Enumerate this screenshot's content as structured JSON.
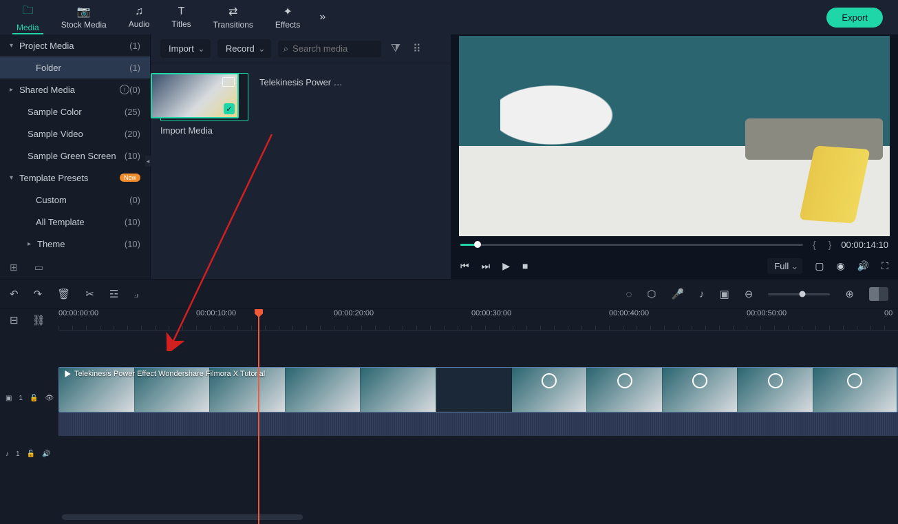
{
  "tabs": {
    "media": "Media",
    "stock": "Stock Media",
    "audio": "Audio",
    "titles": "Titles",
    "transitions": "Transitions",
    "effects": "Effects"
  },
  "export_label": "Export",
  "sidebar": {
    "project_media": {
      "label": "Project Media",
      "count": "(1)"
    },
    "folder": {
      "label": "Folder",
      "count": "(1)"
    },
    "shared_media": {
      "label": "Shared Media",
      "count": "(0)"
    },
    "sample_color": {
      "label": "Sample Color",
      "count": "(25)"
    },
    "sample_video": {
      "label": "Sample Video",
      "count": "(20)"
    },
    "sample_green": {
      "label": "Sample Green Screen",
      "count": "(10)"
    },
    "template_presets": {
      "label": "Template Presets",
      "badge": "New"
    },
    "custom": {
      "label": "Custom",
      "count": "(0)"
    },
    "all_template": {
      "label": "All Template",
      "count": "(10)"
    },
    "theme": {
      "label": "Theme",
      "count": "(10)"
    }
  },
  "media_toolbar": {
    "import": "Import",
    "record": "Record",
    "search_placeholder": "Search media"
  },
  "media_cards": {
    "import": "Import Media",
    "clip1": "Telekinesis Power Eff..."
  },
  "preview": {
    "timecode": "00:00:14:10",
    "resolution": "Full"
  },
  "timeline": {
    "ruler": [
      "00:00:00:00",
      "00:00:10:00",
      "00:00:20:00",
      "00:00:30:00",
      "00:00:40:00",
      "00:00:50:00",
      "00"
    ],
    "clip_title": "Telekinesis Power Effect   Wondershare Filmora X Tutorial",
    "video_track": "1",
    "audio_track": "1"
  }
}
